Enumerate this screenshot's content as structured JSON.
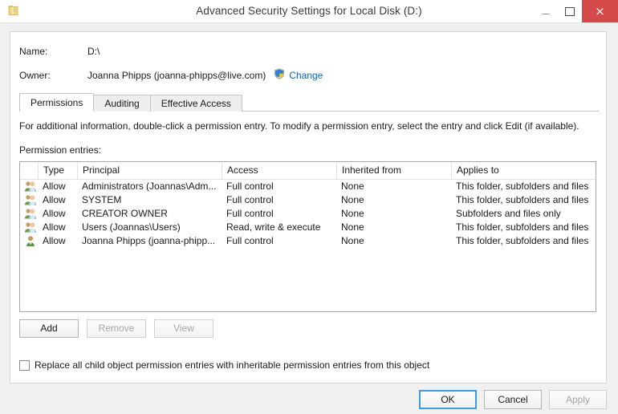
{
  "window": {
    "title": "Advanced Security Settings for Local Disk (D:)",
    "icon": "folder-icon",
    "minimize_label": "–",
    "maximize_label": "□",
    "close_label": "×",
    "close_color": "#d44a4a"
  },
  "header": {
    "name_label": "Name:",
    "name_value": "D:\\",
    "owner_label": "Owner:",
    "owner_value": "Joanna Phipps (joanna-phipps@live.com)",
    "change_link": "Change",
    "change_icon": "uac-shield-icon",
    "link_color": "#0066cc"
  },
  "tabs": [
    {
      "label": "Permissions",
      "active": true
    },
    {
      "label": "Auditing",
      "active": false
    },
    {
      "label": "Effective Access",
      "active": false
    }
  ],
  "permissions": {
    "info_text": "For additional information, double-click a permission entry. To modify a permission entry, select the entry and click Edit (if available).",
    "entries_label": "Permission entries:",
    "columns": [
      "",
      "Type",
      "Principal",
      "Access",
      "Inherited from",
      "Applies to"
    ],
    "rows": [
      {
        "icon": "group-icon",
        "type": "Allow",
        "principal": "Administrators (Joannas\\Adm...",
        "access": "Full control",
        "inherited_from": "None",
        "applies_to": "This folder, subfolders and files"
      },
      {
        "icon": "group-icon",
        "type": "Allow",
        "principal": "SYSTEM",
        "access": "Full control",
        "inherited_from": "None",
        "applies_to": "This folder, subfolders and files"
      },
      {
        "icon": "group-icon",
        "type": "Allow",
        "principal": "CREATOR OWNER",
        "access": "Full control",
        "inherited_from": "None",
        "applies_to": "Subfolders and files only"
      },
      {
        "icon": "group-icon",
        "type": "Allow",
        "principal": "Users (Joannas\\Users)",
        "access": "Read, write & execute",
        "inherited_from": "None",
        "applies_to": "This folder, subfolders and files"
      },
      {
        "icon": "user-icon",
        "type": "Allow",
        "principal": "Joanna Phipps (joanna-phipp...",
        "access": "Full control",
        "inherited_from": "None",
        "applies_to": "This folder, subfolders and files"
      }
    ]
  },
  "actions": {
    "add": "Add",
    "remove": "Remove",
    "view": "View"
  },
  "replace_checkbox": {
    "label": "Replace all child object permission entries with inheritable permission entries from this object",
    "checked": false
  },
  "footer": {
    "ok": "OK",
    "cancel": "Cancel",
    "apply": "Apply"
  }
}
